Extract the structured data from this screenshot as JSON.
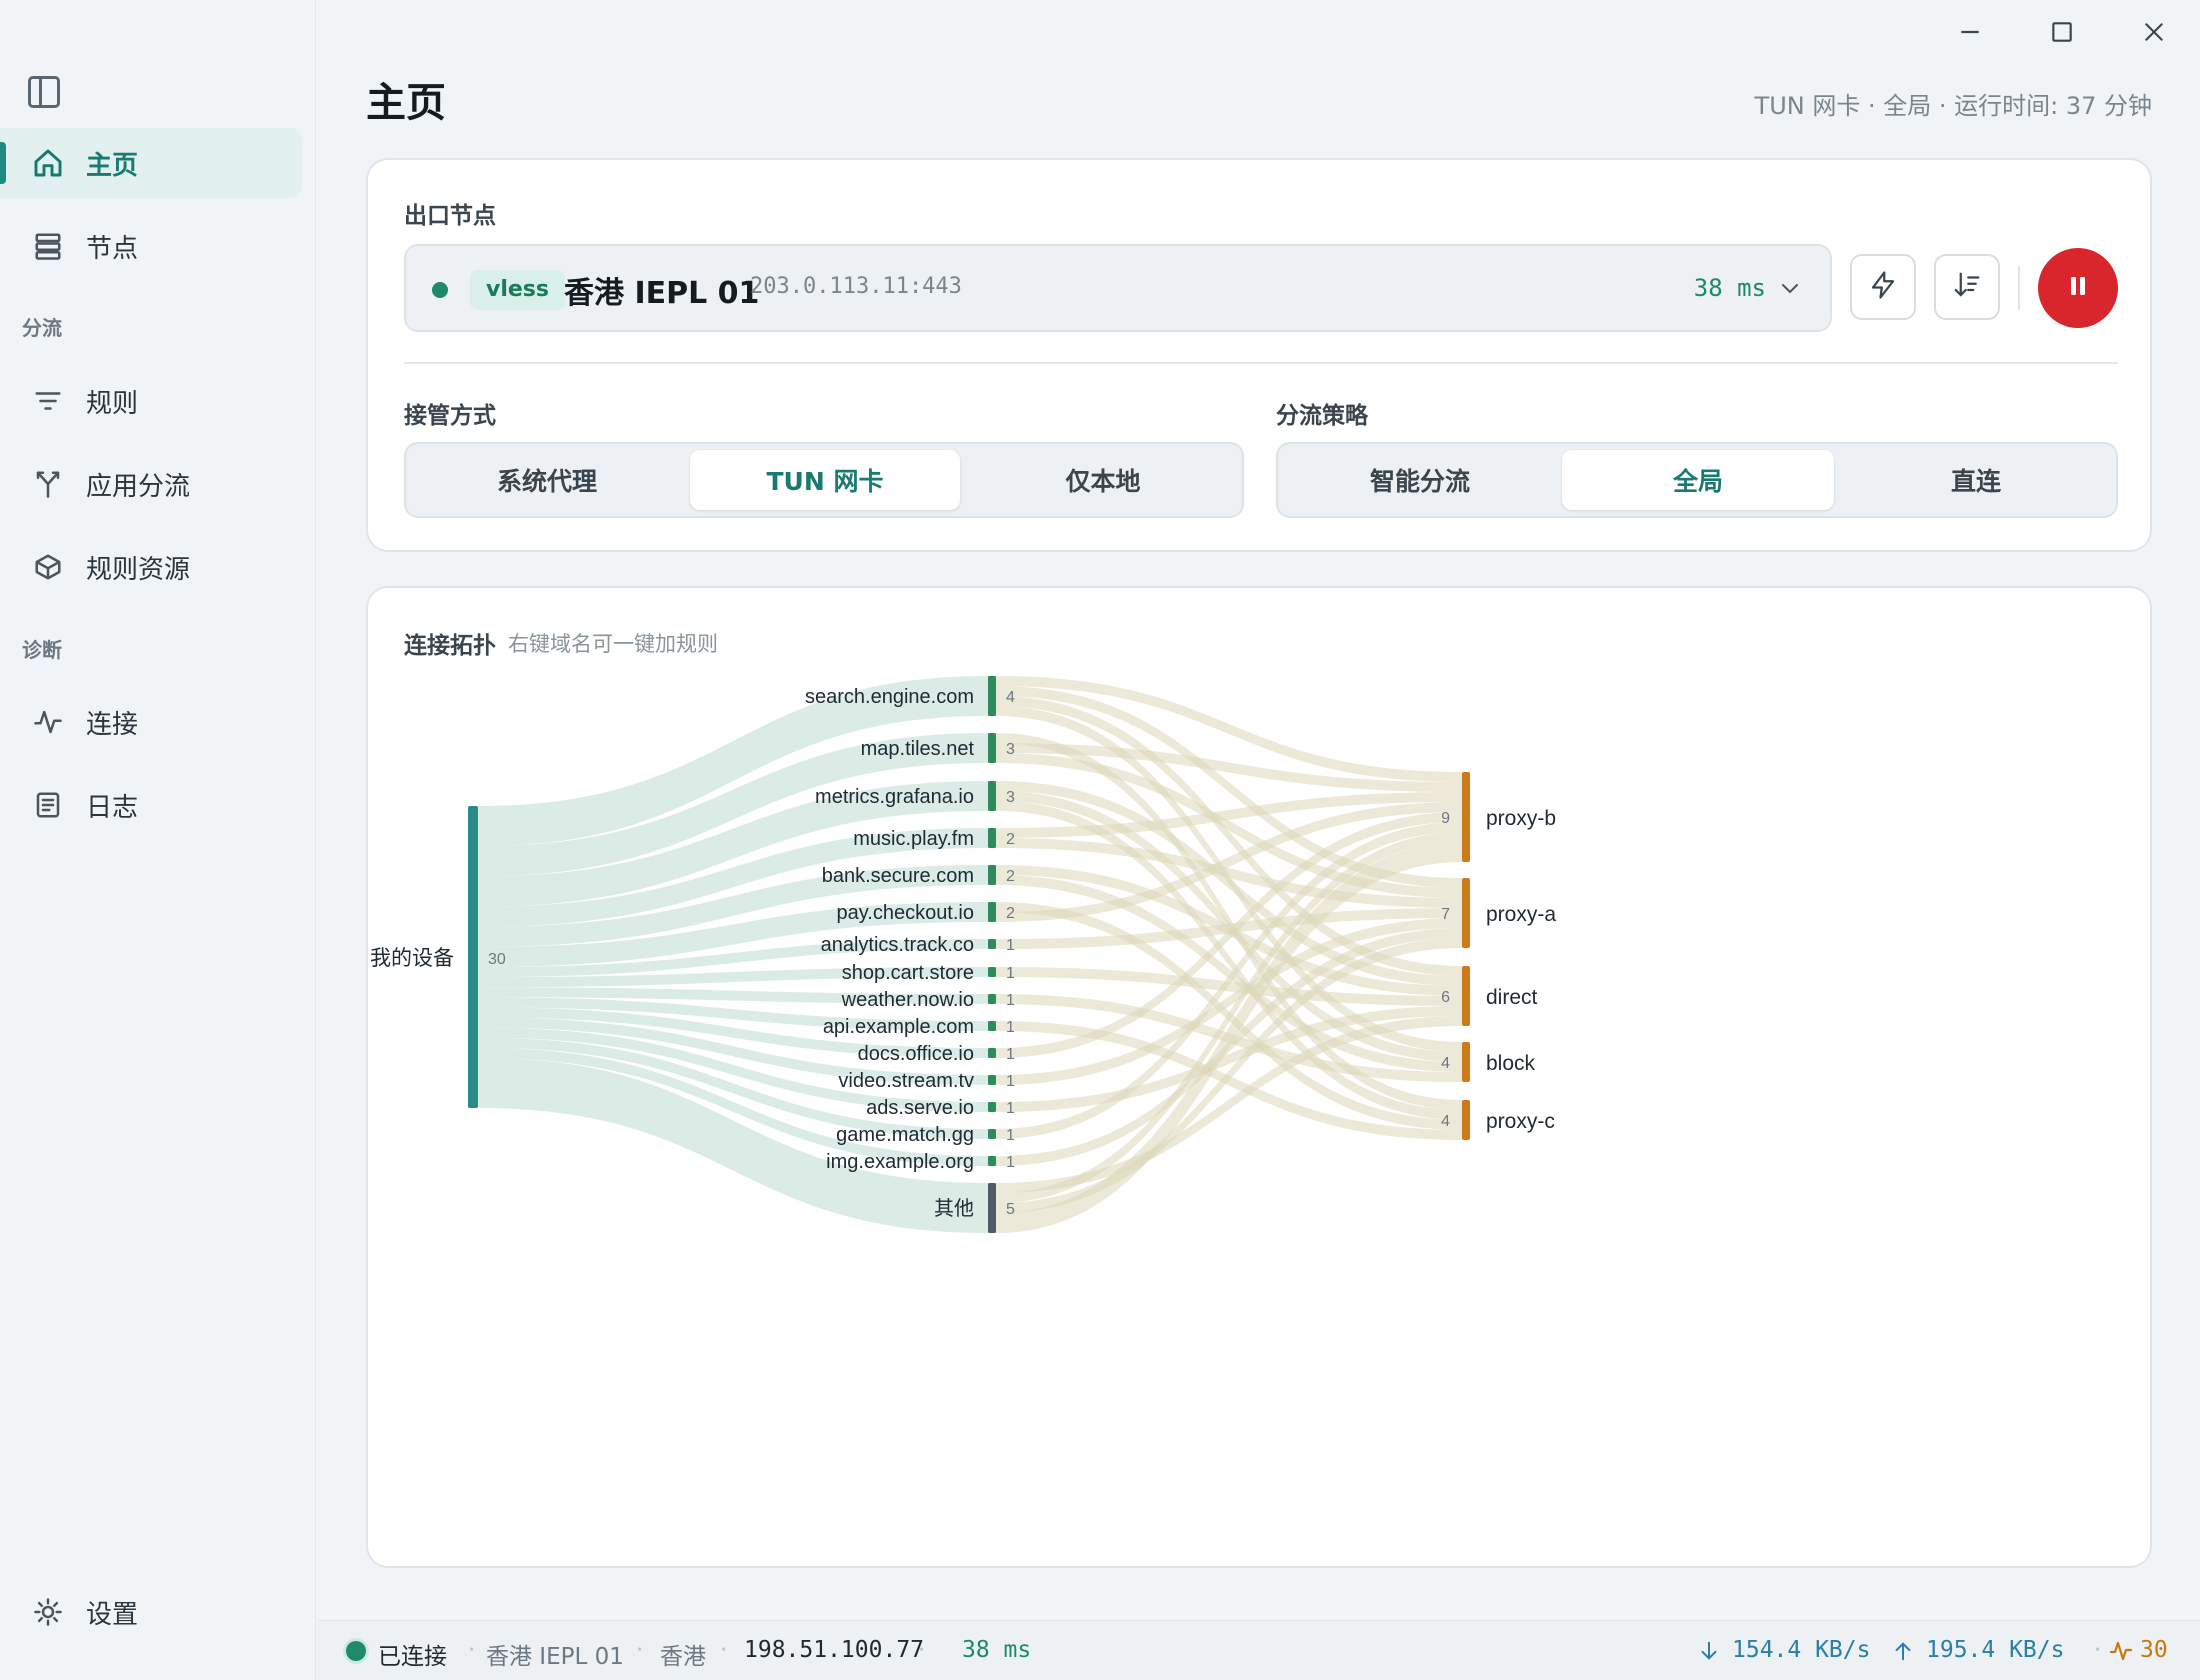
{
  "sidebar": {
    "sections": {
      "routing": "分流",
      "diagnostics": "诊断"
    },
    "items": [
      {
        "label": "主页"
      },
      {
        "label": "节点"
      },
      {
        "label": "规则"
      },
      {
        "label": "应用分流"
      },
      {
        "label": "规则资源"
      },
      {
        "label": "连接"
      },
      {
        "label": "日志"
      },
      {
        "label": "设置"
      }
    ]
  },
  "header": {
    "title": "主页",
    "meta": "TUN 网卡 · 全局 · 运行时间: 37 分钟"
  },
  "exit_node": {
    "label": "出口节点",
    "protocol": "vless",
    "name": "香港 IEPL 01",
    "address": "203.0.113.11:443",
    "latency": "38 ms"
  },
  "takeover": {
    "label": "接管方式",
    "options": [
      "系统代理",
      "TUN 网卡",
      "仅本地"
    ],
    "selected": "TUN 网卡"
  },
  "strategy": {
    "label": "分流策略",
    "options": [
      "智能分流",
      "全局",
      "直连"
    ],
    "selected": "全局"
  },
  "topology": {
    "title": "连接拓扑",
    "hint": "右键域名可一键加规则",
    "source": {
      "name": "我的设备",
      "count": 30
    },
    "domains": [
      {
        "name": "search.engine.com",
        "count": 4
      },
      {
        "name": "map.tiles.net",
        "count": 3
      },
      {
        "name": "metrics.grafana.io",
        "count": 3
      },
      {
        "name": "music.play.fm",
        "count": 2
      },
      {
        "name": "bank.secure.com",
        "count": 2
      },
      {
        "name": "pay.checkout.io",
        "count": 2
      },
      {
        "name": "analytics.track.co",
        "count": 1
      },
      {
        "name": "shop.cart.store",
        "count": 1
      },
      {
        "name": "weather.now.io",
        "count": 1
      },
      {
        "name": "api.example.com",
        "count": 1
      },
      {
        "name": "docs.office.io",
        "count": 1
      },
      {
        "name": "video.stream.tv",
        "count": 1
      },
      {
        "name": "ads.serve.io",
        "count": 1
      },
      {
        "name": "game.match.gg",
        "count": 1
      },
      {
        "name": "img.example.org",
        "count": 1
      },
      {
        "name": "其他",
        "count": 5
      }
    ],
    "outbounds": [
      {
        "name": "proxy-b",
        "count": 9
      },
      {
        "name": "proxy-a",
        "count": 7
      },
      {
        "name": "direct",
        "count": 6
      },
      {
        "name": "block",
        "count": 4
      },
      {
        "name": "proxy-c",
        "count": 4
      }
    ],
    "colors": {
      "source": "#2a8a86",
      "domain": "#2e8b5f",
      "other": "#4f5b66",
      "outbound": "#cf7a1a",
      "flow_left": "#cfe6df",
      "flow_right": "#dcd7b8"
    }
  },
  "status": {
    "state": "已连接",
    "node": "香港 IEPL 01",
    "region": "香港",
    "ip": "198.51.100.77",
    "latency": "38 ms",
    "download": "154.4 KB/s",
    "upload": "195.4 KB/s",
    "connections": "30"
  }
}
